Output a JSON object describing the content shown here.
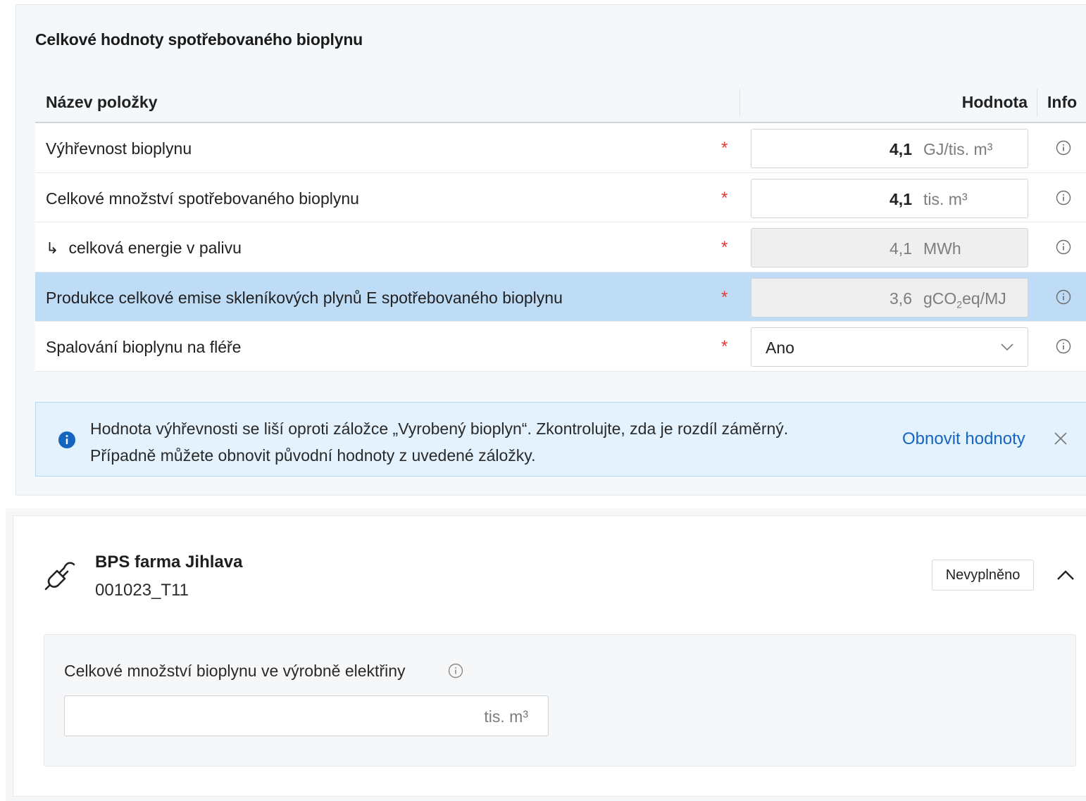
{
  "section": {
    "title": "Celkové hodnoty spotřebovaného bioplynu",
    "table": {
      "headers": {
        "name": "Název položky",
        "value": "Hodnota",
        "info": "Info"
      },
      "rows": [
        {
          "label": "Výhřevnost bioplynu",
          "required_mark": "*",
          "value": "4,1",
          "unit": "GJ/tis. m³",
          "editable": true
        },
        {
          "label": "Celkové množství spotřebovaného bioplynu",
          "required_mark": "*",
          "value": "4,1",
          "unit": "tis. m³",
          "editable": true
        },
        {
          "label": "celková energie v palivu",
          "sub_arrow": "↳",
          "required_mark": "*",
          "value": "4,1",
          "unit": "MWh",
          "editable": false
        },
        {
          "label": "Produkce celkové emise skleníkových plynů E spotřebovaného bioplynu",
          "required_mark": "*",
          "value": "3,6",
          "unit_main": "gCO",
          "unit_sub": "2",
          "unit_rest": "eq/MJ",
          "editable": false,
          "highlighted": true
        },
        {
          "label": "Spalování bioplynu na fléře",
          "required_mark": "*",
          "select_value": "Ano"
        }
      ]
    },
    "alert": {
      "line1": "Hodnota výhřevnosti se liší oproti záložce „Vyrobený bioplyn“. Zkontrolujte, zda je rozdíl záměrný.",
      "line2": "Případně můžete obnovit původní hodnoty z uvedené záložky.",
      "action": "Obnovit hodnoty"
    }
  },
  "unit_card": {
    "name": "BPS farma Jihlava",
    "code": "001023_T11",
    "status": "Nevyplněno",
    "field_label": "Celkové množství bioplynu ve výrobně elektřiny",
    "field_value": "",
    "field_unit": "tis. m³"
  },
  "colors": {
    "accent": "#1565c0",
    "required": "#e53935",
    "highlight_row": "#bfdcf6",
    "alert_bg": "#e3f2fc"
  },
  "icons": [
    "info-circle-icon",
    "chevron-down-icon",
    "info-filled-icon",
    "close-icon",
    "plug-icon",
    "chevron-up-icon"
  ]
}
